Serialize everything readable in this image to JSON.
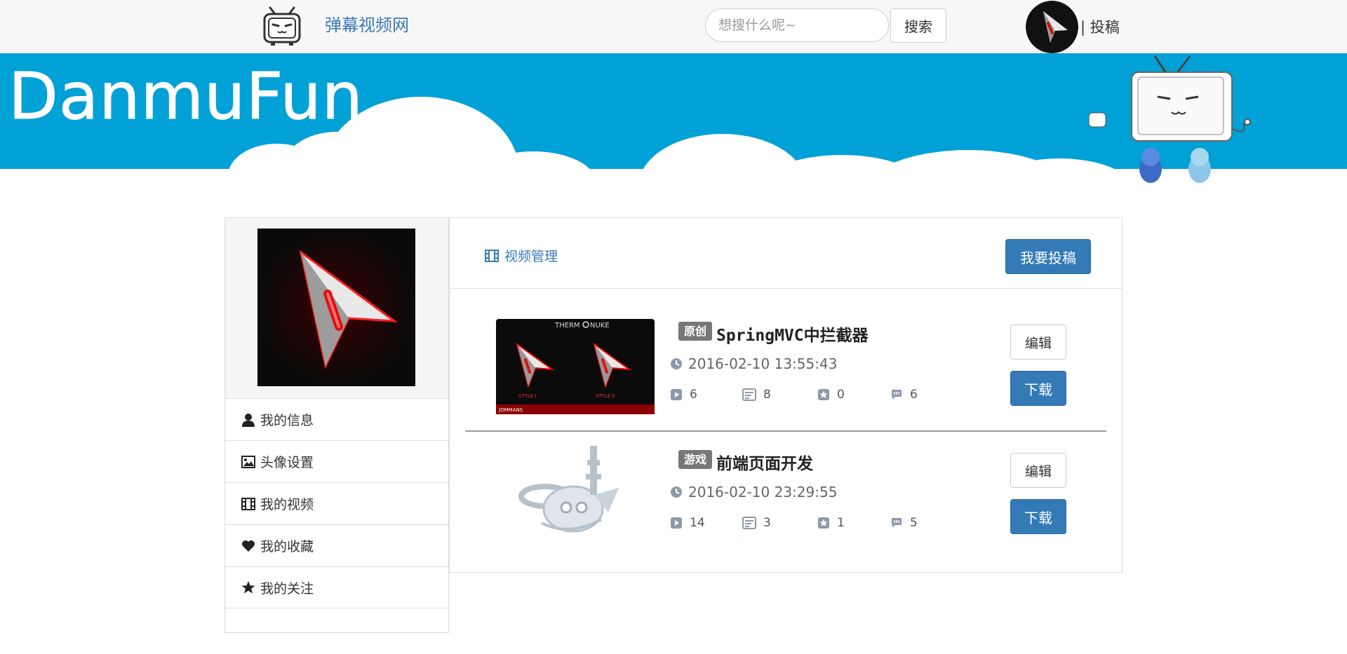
{
  "header": {
    "site_name": "弹幕视频网",
    "search_placeholder": "想搜什么呢~",
    "search_label": "搜索",
    "upload_link": "| 投稿"
  },
  "banner": {
    "logo_text": "DanmuFun",
    "background_color": "#00a1d6"
  },
  "sidebar": {
    "items": [
      {
        "icon": "user-icon",
        "label": "我的信息"
      },
      {
        "icon": "picture-icon",
        "label": "头像设置"
      },
      {
        "icon": "film-icon",
        "label": "我的视频"
      },
      {
        "icon": "heart-icon",
        "label": "我的收藏"
      },
      {
        "icon": "star-icon",
        "label": "我的关注"
      }
    ]
  },
  "main": {
    "title": "视频管理",
    "submit_label": "我要投稿",
    "edit_label": "编辑",
    "download_label": "下载",
    "videos": [
      {
        "tag": "原创",
        "title": "SpringMVC中拦截器",
        "time": "2016-02-10 13:55:43",
        "plays": "6",
        "danmaku": "8",
        "favorites": "0",
        "comments": "6",
        "thumb_texts": [
          "THERM",
          "NUKE",
          "STYLE I",
          "STYLE II",
          "JOMMANS"
        ]
      },
      {
        "tag": "游戏",
        "title": "前端页面开发",
        "time": "2016-02-10 23:29:55",
        "plays": "14",
        "danmaku": "3",
        "favorites": "1",
        "comments": "5"
      }
    ]
  },
  "colors": {
    "accent": "#337ab7",
    "link": "#3a7ab8",
    "tag": "#777777"
  }
}
